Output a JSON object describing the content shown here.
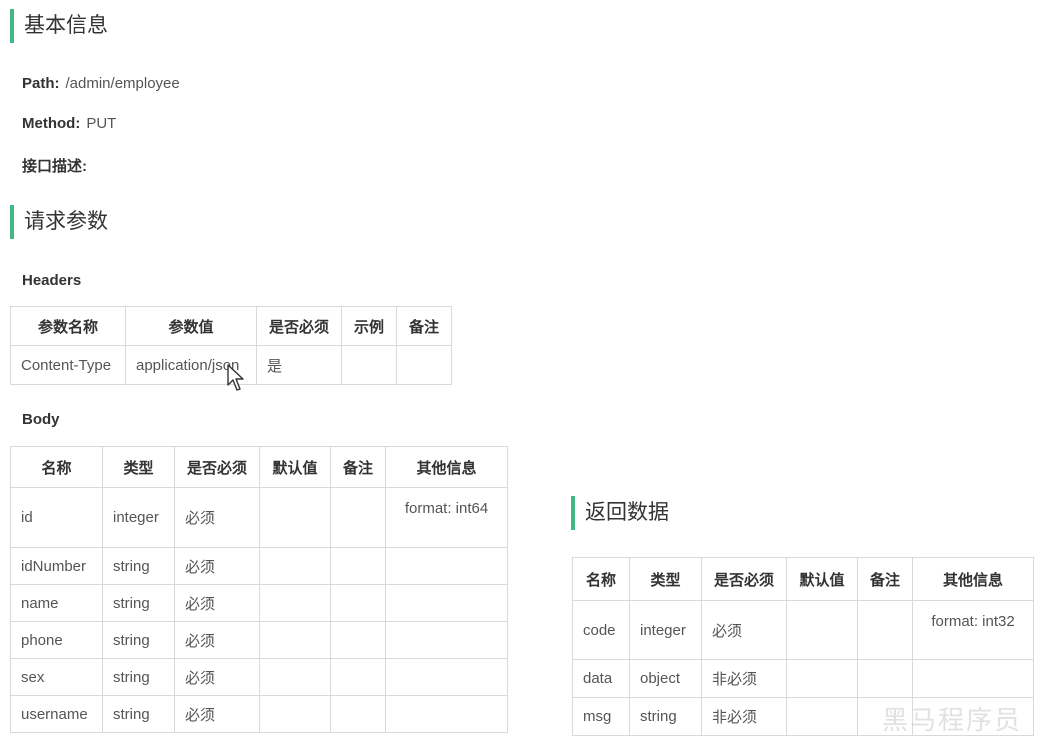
{
  "basic": {
    "title": "基本信息",
    "path_label": "Path:",
    "path_value": "/admin/employee",
    "method_label": "Method:",
    "method_value": "PUT",
    "desc_label": "接口描述:"
  },
  "request": {
    "title": "请求参数",
    "headers_label": "Headers",
    "headers_columns": [
      "参数名称",
      "参数值",
      "是否必须",
      "示例",
      "备注"
    ],
    "headers_rows": [
      [
        "Content-Type",
        "application/json",
        "是",
        "",
        ""
      ]
    ],
    "body_label": "Body",
    "body_columns": [
      "名称",
      "类型",
      "是否必须",
      "默认值",
      "备注",
      "其他信息"
    ],
    "body_rows": [
      [
        "id",
        "integer",
        "必须",
        "",
        "",
        "format: int64"
      ],
      [
        "idNumber",
        "string",
        "必须",
        "",
        "",
        ""
      ],
      [
        "name",
        "string",
        "必须",
        "",
        "",
        ""
      ],
      [
        "phone",
        "string",
        "必须",
        "",
        "",
        ""
      ],
      [
        "sex",
        "string",
        "必须",
        "",
        "",
        ""
      ],
      [
        "username",
        "string",
        "必须",
        "",
        "",
        ""
      ]
    ]
  },
  "response": {
    "title": "返回数据",
    "columns": [
      "名称",
      "类型",
      "是否必须",
      "默认值",
      "备注",
      "其他信息"
    ],
    "rows": [
      [
        "code",
        "integer",
        "必须",
        "",
        "",
        "format: int32"
      ],
      [
        "data",
        "object",
        "非必须",
        "",
        "",
        ""
      ],
      [
        "msg",
        "string",
        "非必须",
        "",
        "",
        ""
      ]
    ]
  },
  "watermark": "黑马程序员",
  "colors": {
    "accent": "#42b983",
    "border": "#d9d9d9",
    "text": "#333333"
  }
}
